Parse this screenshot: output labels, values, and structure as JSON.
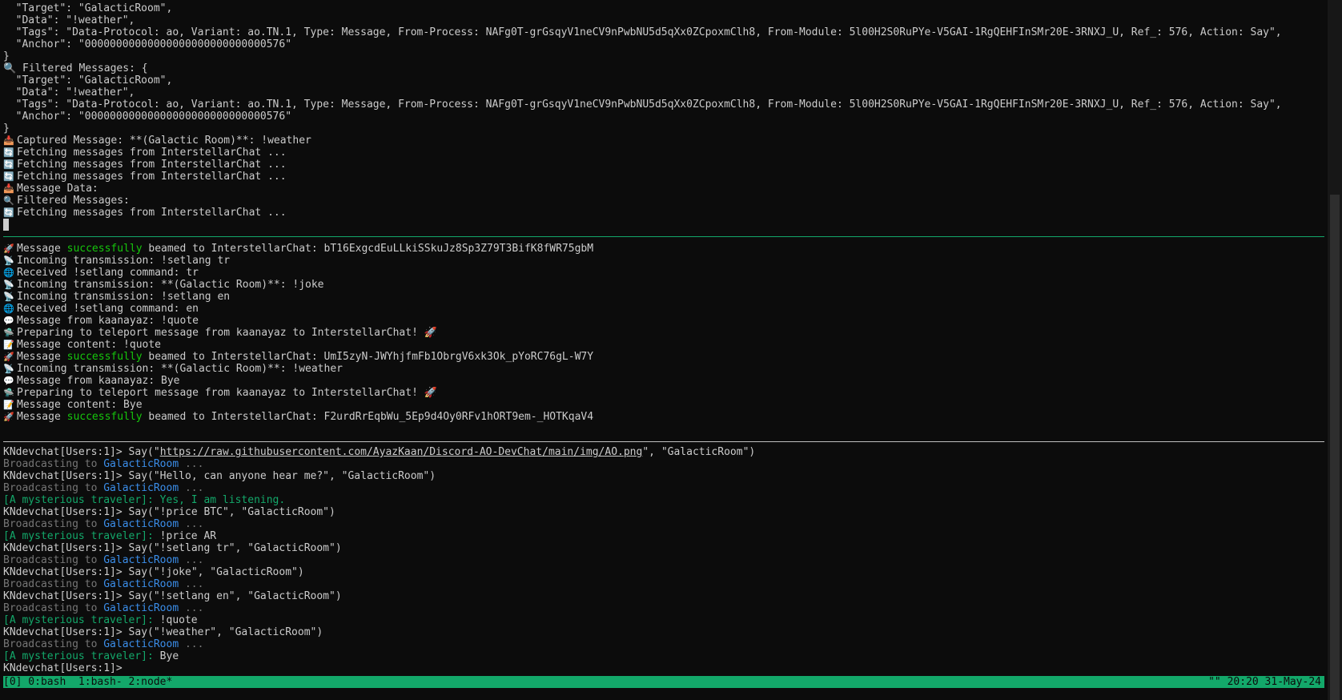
{
  "top_pane": [
    "  \"Target\": \"GalacticRoom\",",
    "  \"Data\": \"!weather\",",
    "  \"Tags\": \"Data-Protocol: ao, Variant: ao.TN.1, Type: Message, From-Process: NAFg0T-grGsqyV1neCV9nPwbNU5d5qXx0ZCpoxmClh8, From-Module: 5l00H2S0RuPYe-V5GAI-1RgQEHFInSMr20E-3RNXJ_U, Ref_: 576, Action: Say\",",
    "  \"Anchor\": \"00000000000000000000000000000576\"",
    "}",
    "🔍 Filtered Messages: {",
    "  \"Target\": \"GalacticRoom\",",
    "  \"Data\": \"!weather\",",
    "  \"Tags\": \"Data-Protocol: ao, Variant: ao.TN.1, Type: Message, From-Process: NAFg0T-grGsqyV1neCV9nPwbNU5d5qXx0ZCpoxmClh8, From-Module: 5l00H2S0RuPYe-V5GAI-1RgQEHFInSMr20E-3RNXJ_U, Ref_: 576, Action: Say\",",
    "  \"Anchor\": \"00000000000000000000000000000576\"",
    "}"
  ],
  "top_pane_events": [
    {
      "icon": "📥",
      "icon_name": "inbox-icon",
      "text": "Captured Message: **(Galactic Room)**: !weather"
    },
    {
      "icon": "🔄",
      "icon_name": "refresh-icon",
      "text": "Fetching messages from InterstellarChat ..."
    },
    {
      "icon": "🔄",
      "icon_name": "refresh-icon",
      "text": "Fetching messages from InterstellarChat ..."
    },
    {
      "icon": "🔄",
      "icon_name": "refresh-icon",
      "text": "Fetching messages from InterstellarChat ..."
    },
    {
      "icon": "📥",
      "icon_name": "inbox-icon",
      "text": "Message Data:"
    },
    {
      "icon": "🔍",
      "icon_name": "search-icon",
      "text": "Filtered Messages:"
    },
    {
      "icon": "🔄",
      "icon_name": "refresh-icon",
      "text": "Fetching messages from InterstellarChat ..."
    }
  ],
  "mid_pane": [
    {
      "icon": "🚀",
      "icon_name": "rocket-icon",
      "pre": "Message ",
      "succ": "successfully",
      "post": " beamed to InterstellarChat: bT16ExgcdEuLLkiSSkuJz8Sp3Z79T3BifK8fWR75gbM"
    },
    {
      "icon": "📡",
      "icon_name": "satellite-icon",
      "pre": "Incoming transmission: !setlang tr",
      "succ": "",
      "post": ""
    },
    {
      "icon": "🌐",
      "icon_name": "globe-icon",
      "pre": "Received !setlang command: tr",
      "succ": "",
      "post": ""
    },
    {
      "icon": "📡",
      "icon_name": "satellite-icon",
      "pre": "Incoming transmission: **(Galactic Room)**: !joke",
      "succ": "",
      "post": ""
    },
    {
      "icon": "📡",
      "icon_name": "satellite-icon",
      "pre": "Incoming transmission: !setlang en",
      "succ": "",
      "post": ""
    },
    {
      "icon": "🌐",
      "icon_name": "globe-icon",
      "pre": "Received !setlang command: en",
      "succ": "",
      "post": ""
    },
    {
      "icon": "💬",
      "icon_name": "speech-bubble-icon",
      "pre": "Message from kaanayaz: !quote",
      "succ": "",
      "post": ""
    },
    {
      "icon": "🛸",
      "icon_name": "ufo-icon",
      "pre": "Preparing to teleport message from kaanayaz to InterstellarChat! 🚀",
      "succ": "",
      "post": ""
    },
    {
      "icon": "📝",
      "icon_name": "memo-icon",
      "pre": "Message content: !quote",
      "succ": "",
      "post": ""
    },
    {
      "icon": "🚀",
      "icon_name": "rocket-icon",
      "pre": "Message ",
      "succ": "successfully",
      "post": " beamed to InterstellarChat: UmI5zyN-JWYhjfmFb1ObrgV6xk3Ok_pYoRC76gL-W7Y"
    },
    {
      "icon": "📡",
      "icon_name": "satellite-icon",
      "pre": "Incoming transmission: **(Galactic Room)**: !weather",
      "succ": "",
      "post": ""
    },
    {
      "icon": "💬",
      "icon_name": "speech-bubble-icon",
      "pre": "Message from kaanayaz: Bye",
      "succ": "",
      "post": ""
    },
    {
      "icon": "🛸",
      "icon_name": "ufo-icon",
      "pre": "Preparing to teleport message from kaanayaz to InterstellarChat! 🚀",
      "succ": "",
      "post": ""
    },
    {
      "icon": "📝",
      "icon_name": "memo-icon",
      "pre": "Message content: Bye",
      "succ": "",
      "post": ""
    },
    {
      "icon": "🚀",
      "icon_name": "rocket-icon",
      "pre": "Message ",
      "succ": "successfully",
      "post": " beamed to InterstellarChat: F2urdRrEqbWu_5Ep9d4Oy0RFv1hORT9em-_HOTKqaV4"
    }
  ],
  "bottom_pane": {
    "prompt": "KNdevchat[Users:1]> ",
    "broadcast_prefix": "Broadcasting to ",
    "broadcast_target": "GalacticRoom",
    "broadcast_suffix": " ...",
    "traveler_label": "[A mysterious traveler]:",
    "first_cmd_pre": "Say(\"",
    "first_cmd_link": "https://raw.githubusercontent.com/AyazKaan/Discord-AO-DevChat/main/img/AO.png",
    "first_cmd_post": "\", \"GalacticRoom\")",
    "cmd_hello": "Say(\"Hello, can anyone hear me?\", \"GalacticRoom\")",
    "reply_listening": " Yes, I am listening.",
    "cmd_price": "Say(\"!price BTC\", \"GalacticRoom\")",
    "reply_price": " !price AR",
    "cmd_setlang_tr": "Say(\"!setlang tr\", \"GalacticRoom\")",
    "cmd_joke": "Say(\"!joke\", \"GalacticRoom\")",
    "cmd_setlang_en": "Say(\"!setlang en\", \"GalacticRoom\")",
    "reply_quote": " !quote",
    "cmd_weather": "Say(\"!weather\", \"GalacticRoom\")",
    "reply_bye": " Bye"
  },
  "statusbar": {
    "windows": "[0] 0:bash  1:bash- 2:node*",
    "right": "\"\" 20:20 31-May-24"
  },
  "colors": {
    "success": "#16c60c",
    "muted": "#767676",
    "channel": "#3b8eea",
    "status_bg": "#13a86a"
  }
}
